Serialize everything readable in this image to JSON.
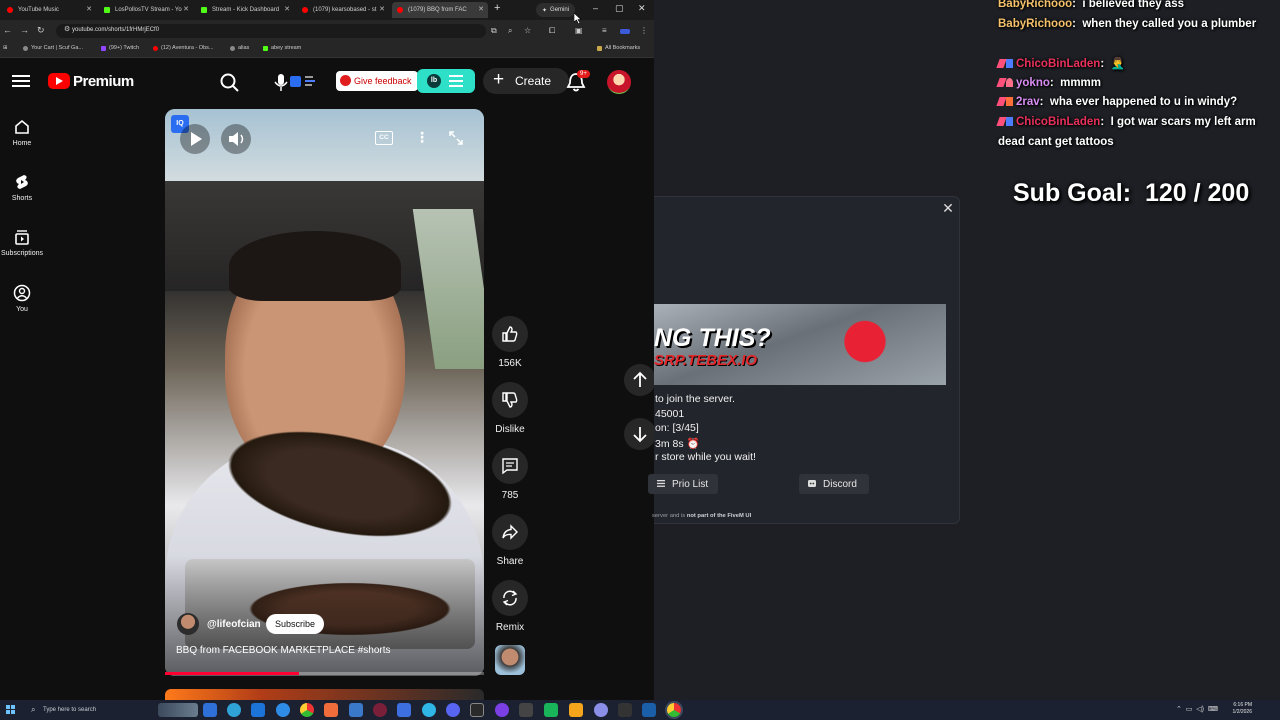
{
  "browser": {
    "tabs": [
      {
        "title": "YouTube Music",
        "color": "#ff0000"
      },
      {
        "title": "LosPollosTV Stream - Yo",
        "color": "#53fc18"
      },
      {
        "title": "Stream - Kick Dashboard",
        "color": "#53fc18"
      },
      {
        "title": "(1079) kearsobased - st",
        "color": "#ff0000"
      },
      {
        "title": "(1079) BBQ from FAC",
        "color": "#ff0000",
        "active": true
      }
    ],
    "gemini_label": "Gemini",
    "url": "youtube.com/shorts/1frHMrjECf0",
    "bookmarks": [
      {
        "label": "Your Cart | Scuf Ga...",
        "color": "#8a8a8a"
      },
      {
        "label": "(99+) Twitch",
        "color": "#9146ff"
      },
      {
        "label": "(12) Aventura - Obs...",
        "color": "#ff0000"
      },
      {
        "label": "alias",
        "color": "#8a8a8a"
      },
      {
        "label": "abey stream",
        "color": "#53fc18"
      }
    ],
    "all_bookmarks_label": "All Bookmarks"
  },
  "youtube": {
    "wordmark": "Premium",
    "feedback_label": "Give feedback",
    "ext_label": "lb",
    "create_label": "Create",
    "notification_count": "9+",
    "sidebar": [
      {
        "label": "Home",
        "icon": "home-icon"
      },
      {
        "label": "Shorts",
        "icon": "shorts-icon"
      },
      {
        "label": "Subscriptions",
        "icon": "subscriptions-icon"
      },
      {
        "label": "You",
        "icon": "you-icon"
      }
    ],
    "ext_tag": "IQ",
    "cc_label": "CC",
    "channel": "@lifeofcian",
    "subscribe_label": "Subscribe",
    "video_title": "BBQ from FACEBOOK MARKETPLACE #shorts",
    "progress": 0.42,
    "actions": {
      "likes": "156K",
      "dislike": "Dislike",
      "comments": "785",
      "share": "Share",
      "remix": "Remix"
    }
  },
  "chat": [
    {
      "user": "BabyRichooo",
      "user_color": "#f5c26b",
      "text": "i believed they ass",
      "badges": []
    },
    {
      "user": "BabyRichooo",
      "user_color": "#f5c26b",
      "text": "when they called you a plumber",
      "badges": []
    },
    {
      "user": "ChicoBinLaden",
      "user_color": "#e8305a",
      "text": "🤦‍♂️",
      "badges": [
        "#ff4f7a",
        "#4d7cff"
      ]
    },
    {
      "user": "yokno",
      "user_color": "#d88ef2",
      "text": "mmmm",
      "badges": [
        "#ff4f7a",
        "#ff6f8a"
      ]
    },
    {
      "user": "2rav",
      "user_color": "#d88ef2",
      "text": "wha ever happened to u in windy?",
      "badges": [
        "#ff4f7a",
        "#ff6f3a"
      ]
    },
    {
      "user": "ChicoBinLaden",
      "user_color": "#e8305a",
      "text": "I got war scars my left arm dead cant get tattoos",
      "badges": [
        "#ff4f7a",
        "#4d7cff"
      ]
    }
  ],
  "sub_goal": {
    "label": "Sub Goal:",
    "current": 120,
    "target": 200,
    "text": "120 / 200"
  },
  "queue": {
    "banner_headline": "NG THIS?",
    "banner_subline": "SRP.TEBEX.IO",
    "lines": [
      "to join the server.",
      "45001",
      "on: [3/45]",
      "3m 8s ⏰",
      "r store while you wait!"
    ],
    "prio_label": "Prio List",
    "discord_label": "Discord",
    "footer_prefix": "server and is",
    "footer_bold": "not part of the FiveM UI"
  },
  "taskbar": {
    "search_placeholder": "Type here to search",
    "clock_time": "6:16 PM",
    "clock_date": "1/2/2026"
  }
}
